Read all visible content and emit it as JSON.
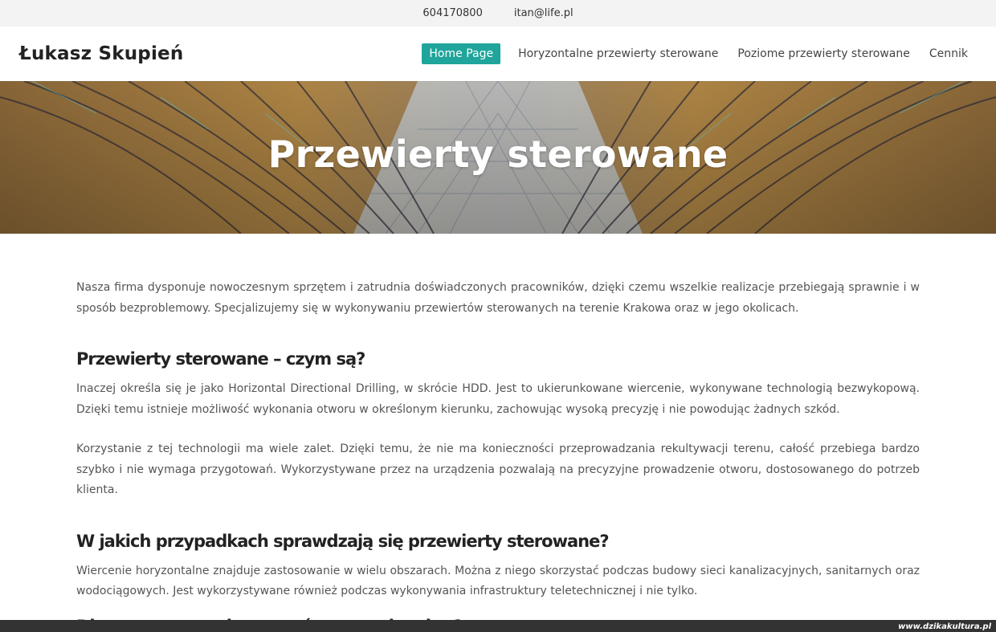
{
  "topbar": {
    "phone": "604170800",
    "email": "itan@life.pl"
  },
  "header": {
    "logo": "Łukasz Skupień",
    "nav": [
      {
        "label": "Home Page",
        "active": true
      },
      {
        "label": "Horyzontalne przewierty sterowane",
        "active": false
      },
      {
        "label": "Poziome przewierty sterowane",
        "active": false
      },
      {
        "label": "Cennik",
        "active": false
      }
    ]
  },
  "hero": {
    "title": "Przewierty sterowane"
  },
  "content": {
    "intro": "Nasza firma dysponuje nowoczesnym sprzętem i zatrudnia doświadczonych pracowników, dzięki czemu wszelkie realizacje przebiegają sprawnie i w sposób bezproblemowy. Specjalizujemy się w wykonywaniu przewiertów sterowanych na terenie Krakowa oraz w jego okolicach.",
    "section1": {
      "heading": "Przewierty sterowane – czym są?",
      "p1": "Inaczej określa się je jako Horizontal Directional Drilling, w skrócie HDD. Jest to ukierunkowane wiercenie, wykonywane technologią bezwykopową. Dzięki temu istnieje możliwość wykonania otworu w określonym kierunku, zachowując wysoką precyzję i nie powodując żadnych szkód.",
      "p2": "Korzystanie z tej technologii ma wiele zalet. Dzięki temu, że nie ma konieczności przeprowadzania rekultywacji terenu, całość przebiega bardzo szybko i nie wymaga przygotowań. Wykorzystywane przez na urządzenia pozwalają na precyzyjne prowadzenie otworu, dostosowanego do potrzeb klienta."
    },
    "section2": {
      "heading": "W jakich przypadkach sprawdzają się przewierty sterowane?",
      "p1": "Wiercenie horyzontalne znajduje zastosowanie w wielu obszarach. Można z niego skorzystać podczas budowy sieci kanalizacyjnych, sanitarnych oraz wodociągowych. Jest wykorzystywane również podczas wykonywania infrastruktury teletechnicznej i nie tylko."
    },
    "section3": {
      "heading": "Dlaczego warto skorzystać z naszych usług?"
    }
  },
  "watermark": "www.dzikakultura.pl",
  "colors": {
    "accent": "#1fa59b",
    "hero_base": "#a67a3c"
  }
}
